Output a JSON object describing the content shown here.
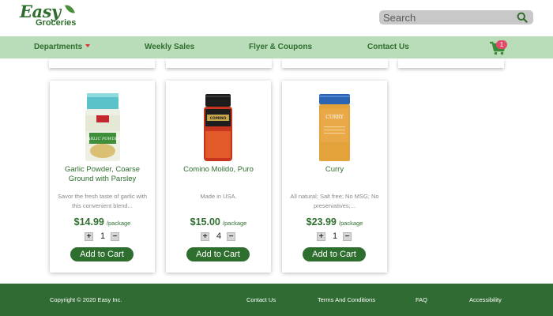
{
  "logo": {
    "line1": "Easy",
    "line2": "Groceries"
  },
  "search": {
    "placeholder": "Search"
  },
  "nav": {
    "departments": "Departments",
    "weekly_sales": "Weekly Sales",
    "flyer": "Flyer & Coupons",
    "contact": "Contact Us",
    "cart_count": "1"
  },
  "products": [
    {
      "name": "Garlic Powder, Coarse Ground with Parsley",
      "description": "Savor the fresh taste of garlic with this convenient blend...",
      "price": "$14.99",
      "unit": "/package",
      "quantity": "1",
      "add_label": "Add to Cart"
    },
    {
      "name": "Comino Molido, Puro",
      "description": "Made in USA.",
      "price": "$15.00",
      "unit": "/package",
      "quantity": "4",
      "add_label": "Add to Cart"
    },
    {
      "name": "Curry",
      "description": "All natural; Salt free; No MSG; No preservatives;...",
      "price": "$23.99",
      "unit": "/package",
      "quantity": "1",
      "add_label": "Add to Cart"
    }
  ],
  "qty_controls": {
    "plus": "+",
    "minus": "−"
  },
  "jar_labels": {
    "jar1": "GARLIC POWDER",
    "jar2": "COMINO",
    "jar3": "CURRY"
  },
  "footer": {
    "copyright": "Copyright © 2020 Easy Inc.",
    "contact": "Contact Us",
    "terms": "Terms And Conditions",
    "faq": "FAQ",
    "accessibility": "Accessibility"
  },
  "colors": {
    "brand_green": "#2e6e2e",
    "nav_bg": "#b9dcb9",
    "footer_bg": "#2f6b32",
    "badge": "#e34b6a"
  }
}
